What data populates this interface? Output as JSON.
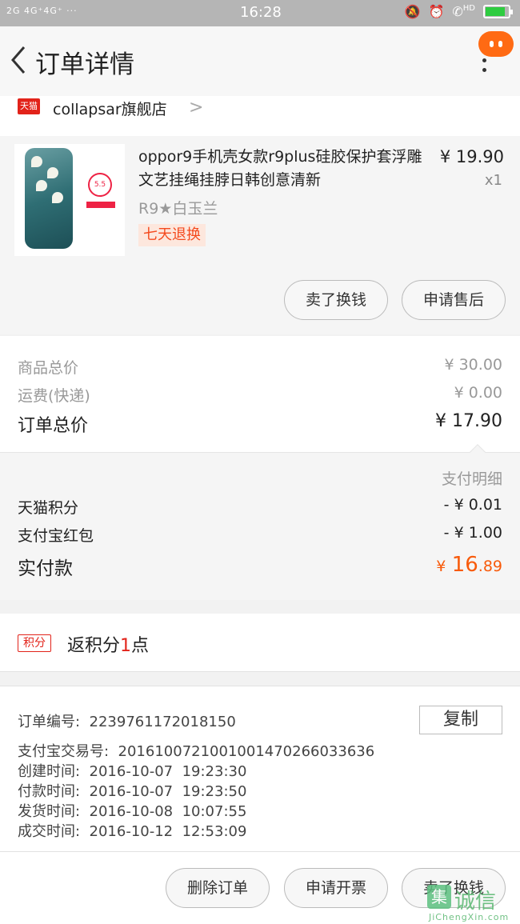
{
  "status_bar": {
    "network": "2G 4G⁺4G⁺ ···",
    "time": "16:28",
    "icons": [
      "bell-off-icon",
      "alarm-icon",
      "hd-call-icon",
      "battery-icon"
    ],
    "hd_label": "HD"
  },
  "header": {
    "title": "订单详情"
  },
  "store": {
    "badge": "天猫",
    "name": "collapsar旗舰店"
  },
  "product": {
    "title": "oppor9手机壳女款r9plus硅胶保护套浮雕文艺挂绳挂脖日韩创意清新",
    "price": "¥ 19.90",
    "quantity": "x1",
    "sku": "R9★白玉兰",
    "return_policy": "七天退换",
    "thumb_badge": "5.5",
    "actions": [
      "卖了换钱",
      "申请售后"
    ]
  },
  "summary": {
    "goods_total_label": "商品总价",
    "goods_total_value": "¥ 30.00",
    "shipping_label": "运费(快递)",
    "shipping_value": "¥ 0.00",
    "order_total_label": "订单总价",
    "order_total_value": "¥ 17.90"
  },
  "payment": {
    "details_label": "支付明细",
    "tmall_points_label": "天猫积分",
    "tmall_points_value": "- ¥ 0.01",
    "alipay_redpacket_label": "支付宝红包",
    "alipay_redpacket_value": "- ¥ 1.00",
    "actual_paid_label": "实付款",
    "actual_paid_currency": "¥",
    "actual_paid_integer": "16",
    "actual_paid_decimal": ".89"
  },
  "points": {
    "badge": "积分",
    "text_prefix": "返积分",
    "number": "1",
    "text_suffix": "点"
  },
  "order_info": {
    "order_no_label": "订单编号:",
    "order_no": "2239761172018150",
    "copy_button": "复制",
    "alipay_no_label": "支付宝交易号:",
    "alipay_no": "2016100721001001470266033636",
    "created_label": "创建时间:",
    "created": "2016-10-07  19:23:30",
    "paid_label": "付款时间:",
    "paid": "2016-10-07  19:23:50",
    "shipped_label": "发货时间:",
    "shipped": "2016-10-08  10:07:55",
    "completed_label": "成交时间:",
    "completed": "2016-10-12  12:53:09"
  },
  "bottom_actions": [
    "删除订单",
    "申请开票",
    "卖了换钱"
  ],
  "watermark": {
    "mark": "集",
    "text": "诚信",
    "domain": "JiChengXin.com"
  },
  "colors": {
    "accent_orange": "#f85a0a",
    "tmall_red": "#e2231a",
    "status_bar": "#b5b5b5"
  }
}
